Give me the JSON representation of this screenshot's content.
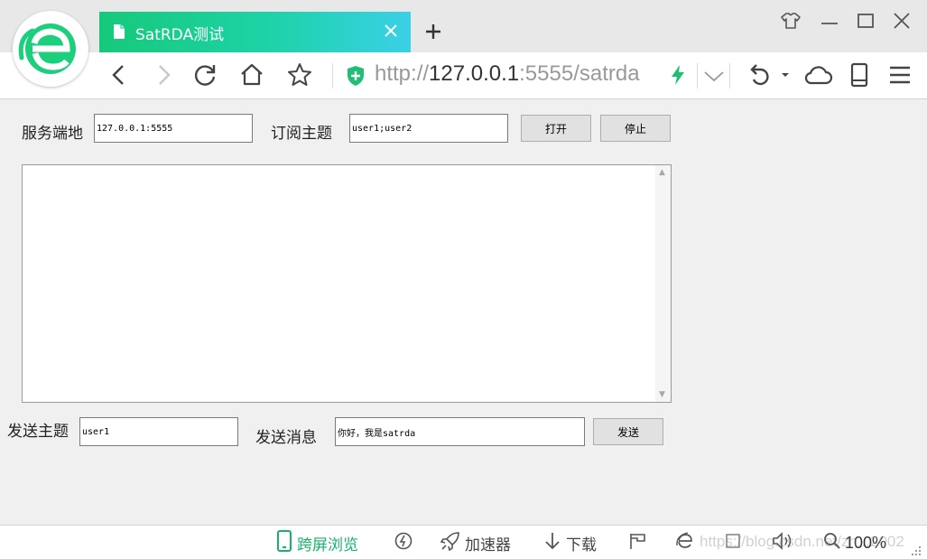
{
  "browser": {
    "tab_title": "SatRDA测试",
    "url_scheme": "http://",
    "url_host": "127.0.0.1",
    "url_rest": ":5555/satrda"
  },
  "form": {
    "server_label": "服务端地",
    "server_value": "127.0.0.1:5555",
    "subscribe_label": "订阅主题",
    "subscribe_value": "user1;user2",
    "open_label": "打开",
    "stop_label": "停止",
    "log_value": "",
    "send_topic_label": "发送主题",
    "send_topic_value": "user1",
    "send_msg_label": "发送消息",
    "send_msg_value": "你好，我是satrda",
    "send_label": "发送"
  },
  "statusbar": {
    "cross_screen": "跨屏浏览",
    "accelerator": "加速器",
    "download": "下载",
    "zoom": "100%",
    "watermark": "https://blog.csdn.net/zh...2002"
  },
  "colors": {
    "tab_gradient_start": "#16c97a",
    "tab_gradient_end": "#3ad0e8",
    "brand_green": "#18b36b",
    "url_host": "#333333",
    "url_dim": "#999999"
  },
  "icons": [
    "browser-logo-icon",
    "document-icon",
    "close-icon",
    "plus-icon",
    "skin-shirt-icon",
    "minimize-icon",
    "maximize-icon",
    "window-close-icon",
    "back-icon",
    "forward-icon",
    "refresh-icon",
    "home-icon",
    "star-icon",
    "shield-icon",
    "bolt-icon",
    "chevron-down-icon",
    "undo-icon",
    "cloud-icon",
    "phone-icon",
    "menu-icon",
    "tablet-icon",
    "speed-icon",
    "rocket-icon",
    "download-icon",
    "flag-icon",
    "ie-icon",
    "screenshot-icon",
    "volume-icon",
    "zoom-icon"
  ]
}
